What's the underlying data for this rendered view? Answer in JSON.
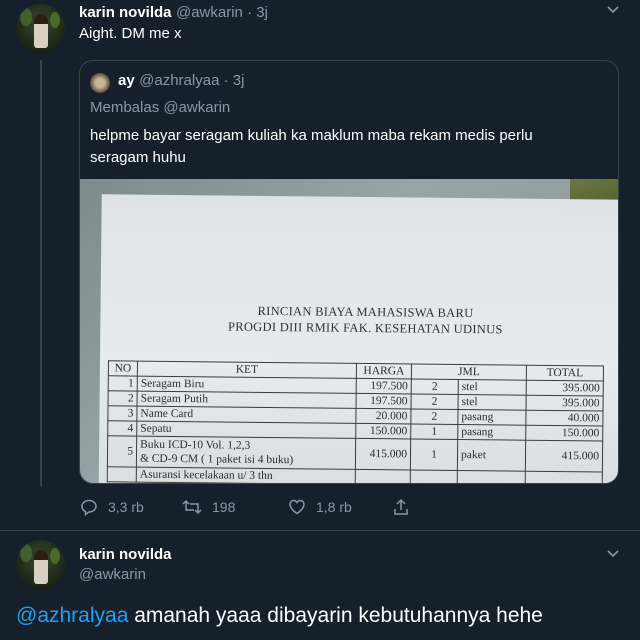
{
  "tweet1": {
    "name": "karin novilda",
    "handle": "@awkarin · 3j",
    "text": "Aight. DM me x"
  },
  "quoted": {
    "name": "ay",
    "handle": "@azhralyaa · 3j",
    "replying": "Membalas @awkarin",
    "text_line1": "helpme bayar seragam kuliah ka maklum maba rekam medis perlu",
    "text_line2": "seragam huhu"
  },
  "document": {
    "title_line1": "RINCIAN BIAYA MAHASISWA BARU",
    "title_line2": "PROGDI DIII RMIK FAK. KESEHATAN UDINUS",
    "headers": [
      "NO",
      "KET",
      "HARGA",
      "JML",
      "TOTAL"
    ],
    "rows": [
      {
        "no": "1",
        "ket": "Seragam Biru",
        "harga": "197.500",
        "qty": "2",
        "unit": "stel",
        "total": "395.000"
      },
      {
        "no": "2",
        "ket": "Seragam Putih",
        "harga": "197.500",
        "qty": "2",
        "unit": "stel",
        "total": "395.000"
      },
      {
        "no": "3",
        "ket": "Name Card",
        "harga": "20.000",
        "qty": "2",
        "unit": "pasang",
        "total": "40.000"
      },
      {
        "no": "4",
        "ket": "Sepatu",
        "harga": "150.000",
        "qty": "1",
        "unit": "pasang",
        "total": "150.000"
      },
      {
        "no": "5",
        "ket": "Buku ICD-10 Vol. 1,2,3",
        "ket2": "& CD-9 CM ( 1 paket isi 4 buku)",
        "harga": "415.000",
        "qty": "1",
        "unit": "paket",
        "total": "415.000"
      }
    ],
    "partial_row": "Asuransi kecelakaan u/ 3 thn"
  },
  "actions": {
    "replies": "3,3 rb",
    "retweets": "198",
    "likes": "1,8 rb"
  },
  "tweet2": {
    "name": "karin novilda",
    "handle": "@awkarin",
    "mention": "@azhralyaa",
    "text": " amanah yaaa dibayarin kebutuhannya hehe"
  },
  "colors": {
    "background": "#15202b",
    "accent": "#1da1f2",
    "muted": "#8899a6",
    "border": "#38444d"
  }
}
